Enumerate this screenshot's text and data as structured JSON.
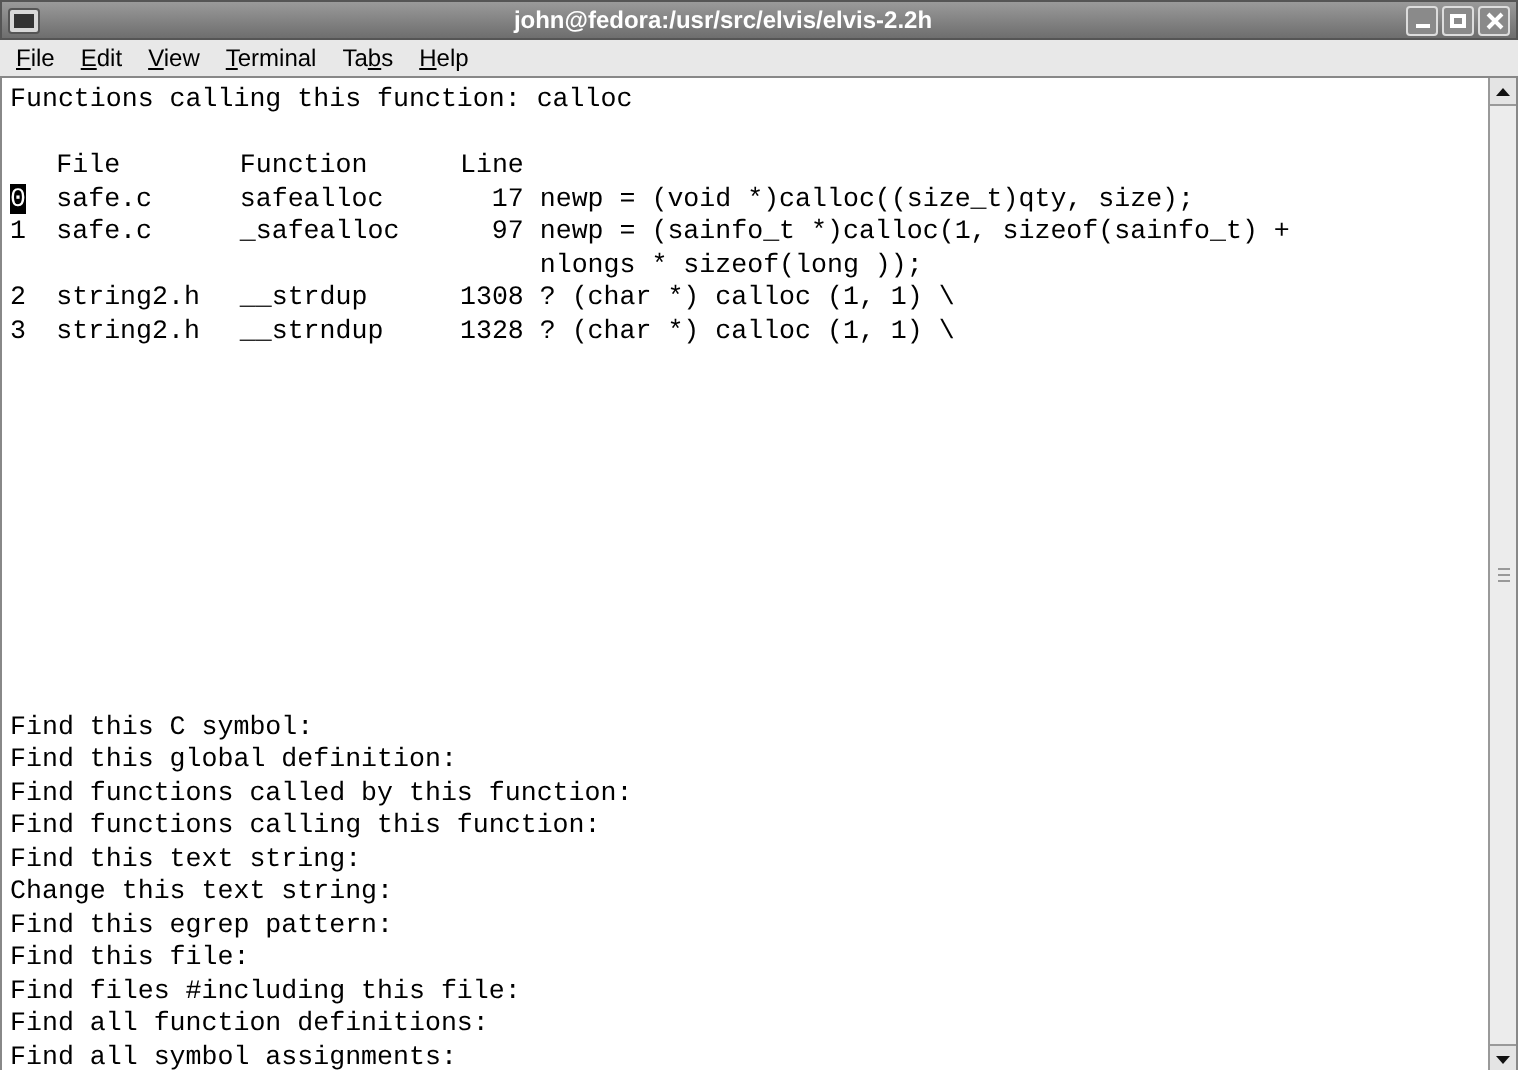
{
  "window": {
    "title": "john@fedora:/usr/src/elvis/elvis-2.2h"
  },
  "menu": [
    {
      "access_key": "F",
      "after": "ile"
    },
    {
      "access_key": "E",
      "after": "dit"
    },
    {
      "access_key": "V",
      "after": "iew"
    },
    {
      "access_key": "T",
      "after": "erminal"
    },
    {
      "before": "Ta",
      "access_key": "b",
      "after": "s"
    },
    {
      "access_key": "H",
      "after": "elp"
    }
  ],
  "terminal": {
    "heading": "Functions calling this function: calloc",
    "columns": [
      "File",
      "Function",
      "Line"
    ],
    "rows": [
      {
        "index": "0",
        "file": "safe.c",
        "function": "safealloc",
        "line": "17",
        "text": [
          "newp = (void *)calloc((size_t)qty, size);"
        ],
        "selected": true
      },
      {
        "index": "1",
        "file": "safe.c",
        "function": "_safealloc",
        "line": "97",
        "text": [
          "newp = (sainfo_t *)calloc(1, sizeof(sainfo_t) +",
          "nlongs * sizeof(long ));"
        ],
        "selected": false
      },
      {
        "index": "2",
        "file": "string2.h",
        "function": "__strdup",
        "line": "1308",
        "text": [
          "? (char *) calloc (1, 1) \\"
        ],
        "selected": false
      },
      {
        "index": "3",
        "file": "string2.h",
        "function": "__strndup",
        "line": "1328",
        "text": [
          "? (char *) calloc (1, 1) \\"
        ],
        "selected": false
      }
    ],
    "prompts": [
      "Find this C symbol:",
      "Find this global definition:",
      "Find functions called by this function:",
      "Find functions calling this function:",
      "Find this text string:",
      "Change this text string:",
      "Find this egrep pattern:",
      "Find this file:",
      "Find files #including this file:",
      "Find all function definitions:",
      "Find all symbol assignments:"
    ]
  }
}
